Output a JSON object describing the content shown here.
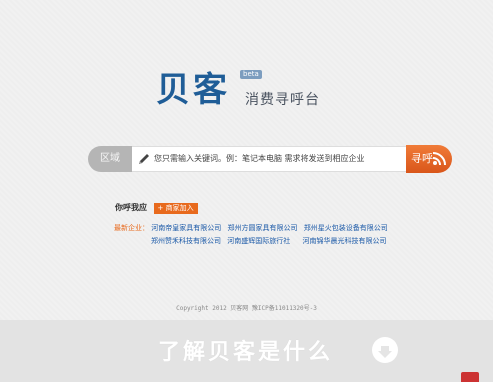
{
  "logo": {
    "mark": "贝客",
    "beta": "beta",
    "tagline": "消费寻呼台"
  },
  "search": {
    "area_label": "区域",
    "placeholder": "您只需输入关键词。例：笔记本电脑 需求将发送到相应企业",
    "button_label": "寻呼"
  },
  "call": {
    "label": "你呼我应",
    "join_label": "+ 商家加入"
  },
  "companies": {
    "label": "最新企业：",
    "row1": [
      "河南帝皇家具有限公司",
      "郑州方圆家具有限公司",
      "郑州星火包装设备有限公司"
    ],
    "row2": [
      "郑州赞禾科技有限公司",
      "河南盛辉国际旅行社",
      "河南锦华晨光科技有限公司"
    ]
  },
  "footer": {
    "copyright": "Copyright 2012 贝客网 豫ICP备11011320号-3"
  },
  "cta": {
    "label": "了解贝客是什么"
  },
  "colors": {
    "brand": "#1f5d97",
    "accent": "#e86a1d",
    "link": "#1c5aa8"
  }
}
